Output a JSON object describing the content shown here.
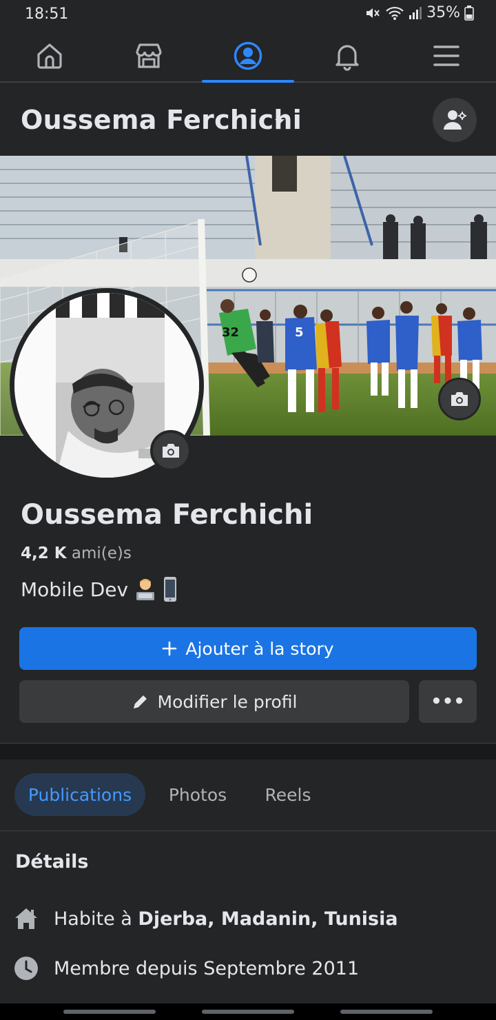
{
  "status_bar": {
    "time": "18:51",
    "battery": "35%"
  },
  "nav": {
    "items": [
      {
        "name": "home",
        "active": false
      },
      {
        "name": "marketplace",
        "active": false
      },
      {
        "name": "profile",
        "active": true
      },
      {
        "name": "notifications",
        "active": false
      },
      {
        "name": "menu",
        "active": false
      }
    ],
    "accent": "#2d88ff"
  },
  "header": {
    "name": "Oussema Ferchichi"
  },
  "profile": {
    "name": "Oussema Ferchichi",
    "friends_count": "4,2 K",
    "friends_label": "ami(e)s",
    "bio": "Mobile Dev"
  },
  "actions": {
    "add_story": "Ajouter à la story",
    "edit_profile": "Modifier le profil",
    "more": "•••"
  },
  "tabs": [
    {
      "label": "Publications",
      "active": true
    },
    {
      "label": "Photos",
      "active": false
    },
    {
      "label": "Reels",
      "active": false
    }
  ],
  "details": {
    "title": "Détails",
    "rows": [
      {
        "icon": "home-icon",
        "prefix": "Habite à ",
        "value": "Djerba, Madanin, Tunisia"
      },
      {
        "icon": "clock-icon",
        "prefix": "Membre depuis Septembre 2011",
        "value": ""
      }
    ]
  },
  "colors": {
    "background": "#242526",
    "primary_button": "#1b74e4",
    "secondary_button": "#3a3b3c",
    "active_tab_bg": "#263951",
    "active_tab_text": "#4599ff"
  }
}
